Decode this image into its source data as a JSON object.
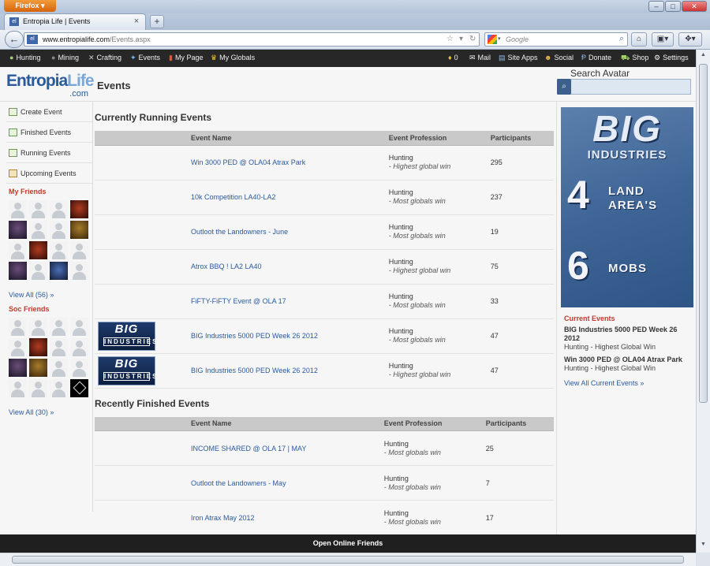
{
  "browser": {
    "app_button": "Firefox",
    "tab_title": "Entropia Life | Events",
    "tab_favicon": "el",
    "url_domain": "www.entropialife.com",
    "url_path": "/Events.aspx",
    "search_placeholder": "Google",
    "window_controls": {
      "minimize": "–",
      "maximize": "□",
      "close": "✕"
    }
  },
  "sitebar": {
    "left": [
      {
        "label": "Hunting",
        "icon": "hunting-icon"
      },
      {
        "label": "Mining",
        "icon": "mining-icon"
      },
      {
        "label": "Crafting",
        "icon": "crafting-icon"
      },
      {
        "label": "Events",
        "icon": "events-icon"
      },
      {
        "label": "My Page",
        "icon": "bookmark-icon"
      },
      {
        "label": "My Globals",
        "icon": "trophy-icon"
      }
    ],
    "notif_count": "0",
    "right": [
      {
        "label": "Mail",
        "icon": "mail-icon"
      },
      {
        "label": "Site Apps",
        "icon": "apps-icon"
      },
      {
        "label": "Social",
        "icon": "social-icon"
      },
      {
        "label": "Donate",
        "icon": "paypal-icon"
      },
      {
        "label": "Shop",
        "icon": "cart-icon"
      },
      {
        "label": "Settings",
        "icon": "gear-icon"
      }
    ]
  },
  "logo": {
    "main1": "Entropia",
    "main2": "Life",
    "sub": ".com"
  },
  "header": {
    "title": "Events",
    "search_label": "Search Avatar",
    "search_value": ""
  },
  "leftnav": {
    "items": [
      {
        "label": "Create Event"
      },
      {
        "label": "Finished Events"
      },
      {
        "label": "Running Events"
      },
      {
        "label": "Upcoming Events"
      }
    ],
    "my_friends": {
      "title": "My Friends",
      "view_all": "View All (56) »"
    },
    "soc_friends": {
      "title": "Soc Friends",
      "view_all": "View All (30) »"
    }
  },
  "running": {
    "title": "Currently Running Events",
    "columns": [
      "Event Name",
      "Event Profession",
      "Participants"
    ],
    "rows": [
      {
        "name": "Win 3000 PED @ OLA04 Atrax Park",
        "prof": "Hunting",
        "sub": "- Highest global win",
        "participants": "295",
        "banner": false
      },
      {
        "name": "10k Competition LA40-LA2",
        "prof": "Hunting",
        "sub": "- Most globals win",
        "participants": "237",
        "banner": false
      },
      {
        "name": "Outloot the Landowners - June",
        "prof": "Hunting",
        "sub": "- Most globals win",
        "participants": "19",
        "banner": false
      },
      {
        "name": "Atrox BBQ ! LA2 LA40",
        "prof": "Hunting",
        "sub": "- Highest global win",
        "participants": "75",
        "banner": false
      },
      {
        "name": "FiFTY-FiFTY Event @ OLA 17",
        "prof": "Hunting",
        "sub": "- Most globals win",
        "participants": "33",
        "banner": false
      },
      {
        "name": "BIG Industries 5000 PED Week 26 2012",
        "prof": "Hunting",
        "sub": "- Most globals win",
        "participants": "47",
        "banner": true
      },
      {
        "name": "BIG Industries 5000 PED Week 26 2012",
        "prof": "Hunting",
        "sub": "- Highest global win",
        "participants": "47",
        "banner": true
      }
    ]
  },
  "finished": {
    "title": "Recently Finished Events",
    "columns": [
      "Event Name",
      "Event Profession",
      "Participants"
    ],
    "rows": [
      {
        "name": "INCOME SHARED @ OLA 17 | MAY",
        "prof": "Hunting",
        "sub": "- Most globals win",
        "participants": "25"
      },
      {
        "name": "Outloot the Landowners - May",
        "prof": "Hunting",
        "sub": "- Most globals win",
        "participants": "7"
      },
      {
        "name": "Iron Atrax May 2012",
        "prof": "Hunting",
        "sub": "- Most globals win",
        "participants": "17"
      }
    ]
  },
  "banner_text": {
    "big": "BIG",
    "industries": "INDUSTRIES"
  },
  "ad": {
    "line1": "BIG",
    "line2": "INDUSTRIES",
    "n1": "4",
    "t1a": "LAND",
    "t1b": "AREA'S",
    "n2": "6",
    "t2": "MOBS"
  },
  "current_events": {
    "title": "Current Events",
    "items": [
      {
        "name": "BIG Industries 5000 PED Week 26 2012",
        "sub": "Hunting - Highest Global Win"
      },
      {
        "name": "Win 3000 PED @ OLA04 Atrax Park",
        "sub": "Hunting - Highest Global Win"
      }
    ],
    "view_all": "View All Current Events »"
  },
  "bottombar": {
    "label": "Open Online Friends"
  }
}
